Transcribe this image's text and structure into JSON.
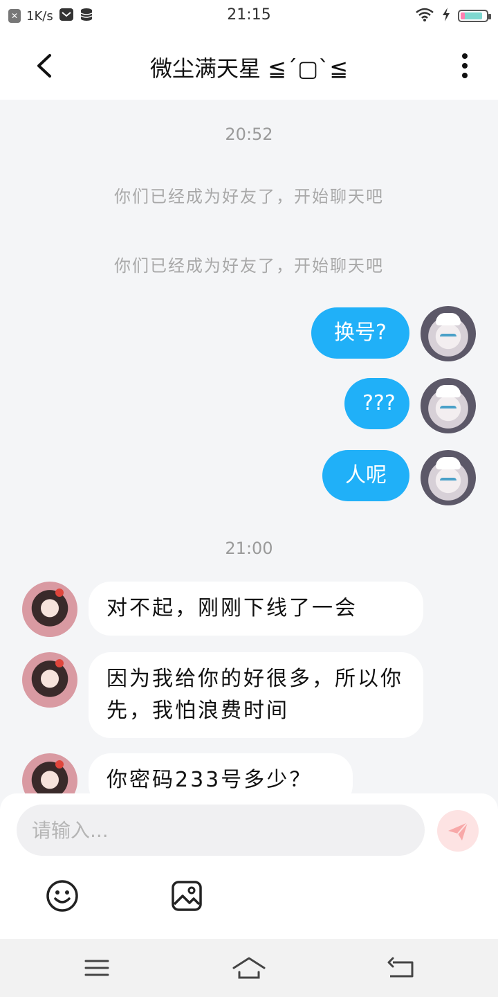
{
  "status_bar": {
    "network_speed": "1K/s",
    "time": "21:15",
    "battery_level": 0.78,
    "icons": [
      "notification-icon",
      "mail-icon",
      "database-icon",
      "wifi-icon",
      "charging-icon",
      "battery-icon"
    ]
  },
  "header": {
    "title": "微尘满天星 ≦´▢`≦",
    "back_icon": "chevron-left-icon",
    "more_icon": "vertical-dots-icon"
  },
  "chat": {
    "timestamps": [
      "20:52",
      "21:00"
    ],
    "system_messages": [
      "你们已经成为好友了，开始聊天吧",
      "你们已经成为好友了，开始聊天吧"
    ],
    "outgoing": [
      {
        "text": "换号?"
      },
      {
        "text": "???"
      },
      {
        "text": "人呢"
      }
    ],
    "incoming": [
      {
        "text": "对不起，刚刚下线了一会"
      },
      {
        "text": "因为我给你的好很多，所以你先，我怕浪费时间"
      },
      {
        "text": "你密码233号多少？"
      }
    ]
  },
  "input": {
    "placeholder": "请输入...",
    "send_icon": "paper-plane-icon",
    "emoji_icon": "smiley-icon",
    "image_icon": "image-icon"
  },
  "nav_bar": {
    "icons": [
      "menu-icon",
      "home-icon",
      "back-icon"
    ]
  },
  "colors": {
    "accent": "#20b0f8",
    "background": "#f4f5f7",
    "send_button": "#fde3e3"
  }
}
